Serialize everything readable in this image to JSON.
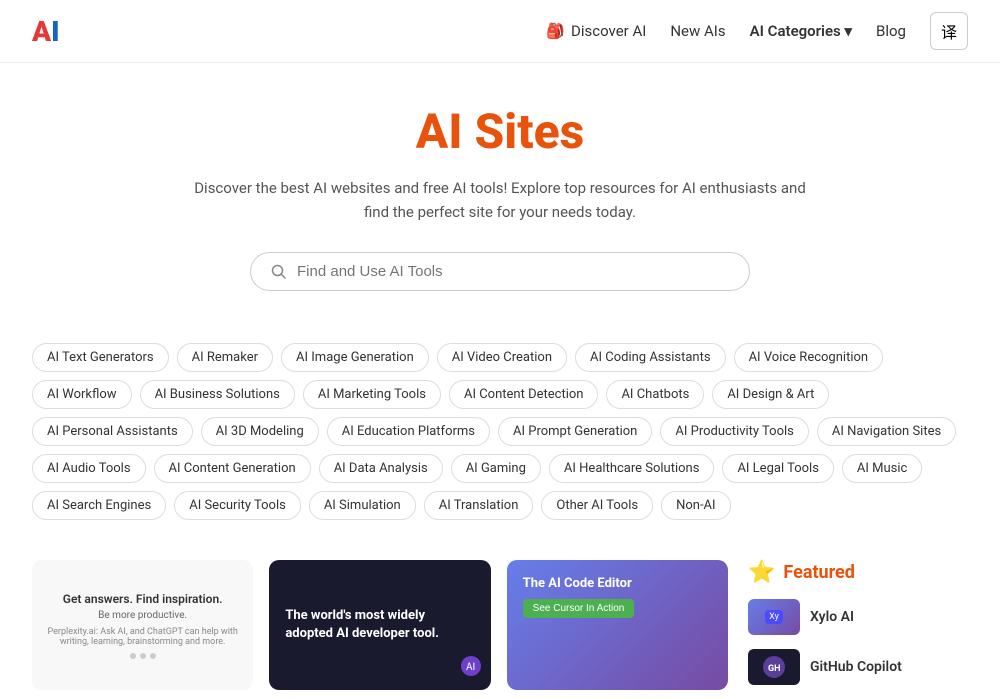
{
  "header": {
    "logo_a": "A",
    "logo_i": "I",
    "nav": [
      {
        "id": "discover",
        "label": "Discover AI",
        "icon": "briefcase",
        "active": false
      },
      {
        "id": "new-ais",
        "label": "New AIs",
        "active": false
      },
      {
        "id": "ai-categories",
        "label": "AI Categories",
        "active": true,
        "has_dropdown": true
      },
      {
        "id": "blog",
        "label": "Blog",
        "active": false
      }
    ],
    "translate_icon": "译"
  },
  "hero": {
    "title": "AI Sites",
    "subtitle": "Discover the best AI websites and free AI tools! Explore top resources for AI enthusiasts and find the perfect site for your needs today."
  },
  "search": {
    "placeholder": "Find and Use AI Tools"
  },
  "tags": [
    "AI Text Generators",
    "AI Remaker",
    "AI Image Generation",
    "AI Video Creation",
    "AI Coding Assistants",
    "AI Voice Recognition",
    "AI Workflow",
    "AI Business Solutions",
    "AI Marketing Tools",
    "AI Content Detection",
    "AI Chatbots",
    "AI Design & Art",
    "AI Personal Assistants",
    "AI 3D Modeling",
    "AI Education Platforms",
    "AI Prompt Generation",
    "AI Productivity Tools",
    "AI Navigation Sites",
    "AI Audio Tools",
    "AI Content Generation",
    "AI Data Analysis",
    "AI Gaming",
    "AI Healthcare Solutions",
    "AI Legal Tools",
    "AI Music",
    "AI Search Engines",
    "AI Security Tools",
    "AI Simulation",
    "AI Translation",
    "Other AI Tools",
    "Non-AI"
  ],
  "cards": [
    {
      "id": "card1",
      "type": "light",
      "title": "Get answers. Find inspiration.",
      "subtitle": "Be more productive.",
      "tagline": "Perplexity.ai: Ask AI, and ChatGPT can help with writing, learning, brainstorming and more."
    },
    {
      "id": "card2",
      "type": "dark",
      "text": "The world's most widely adopted AI developer tool."
    },
    {
      "id": "card3",
      "type": "gradient",
      "title": "The AI Code Editor",
      "button_label": "See Cursor In Action"
    }
  ],
  "featured": {
    "title": "Featured",
    "star": "⭐",
    "items": [
      {
        "id": "xylo",
        "name": "Xylo AI"
      },
      {
        "id": "github",
        "name": "GitHub Copilot"
      }
    ]
  }
}
